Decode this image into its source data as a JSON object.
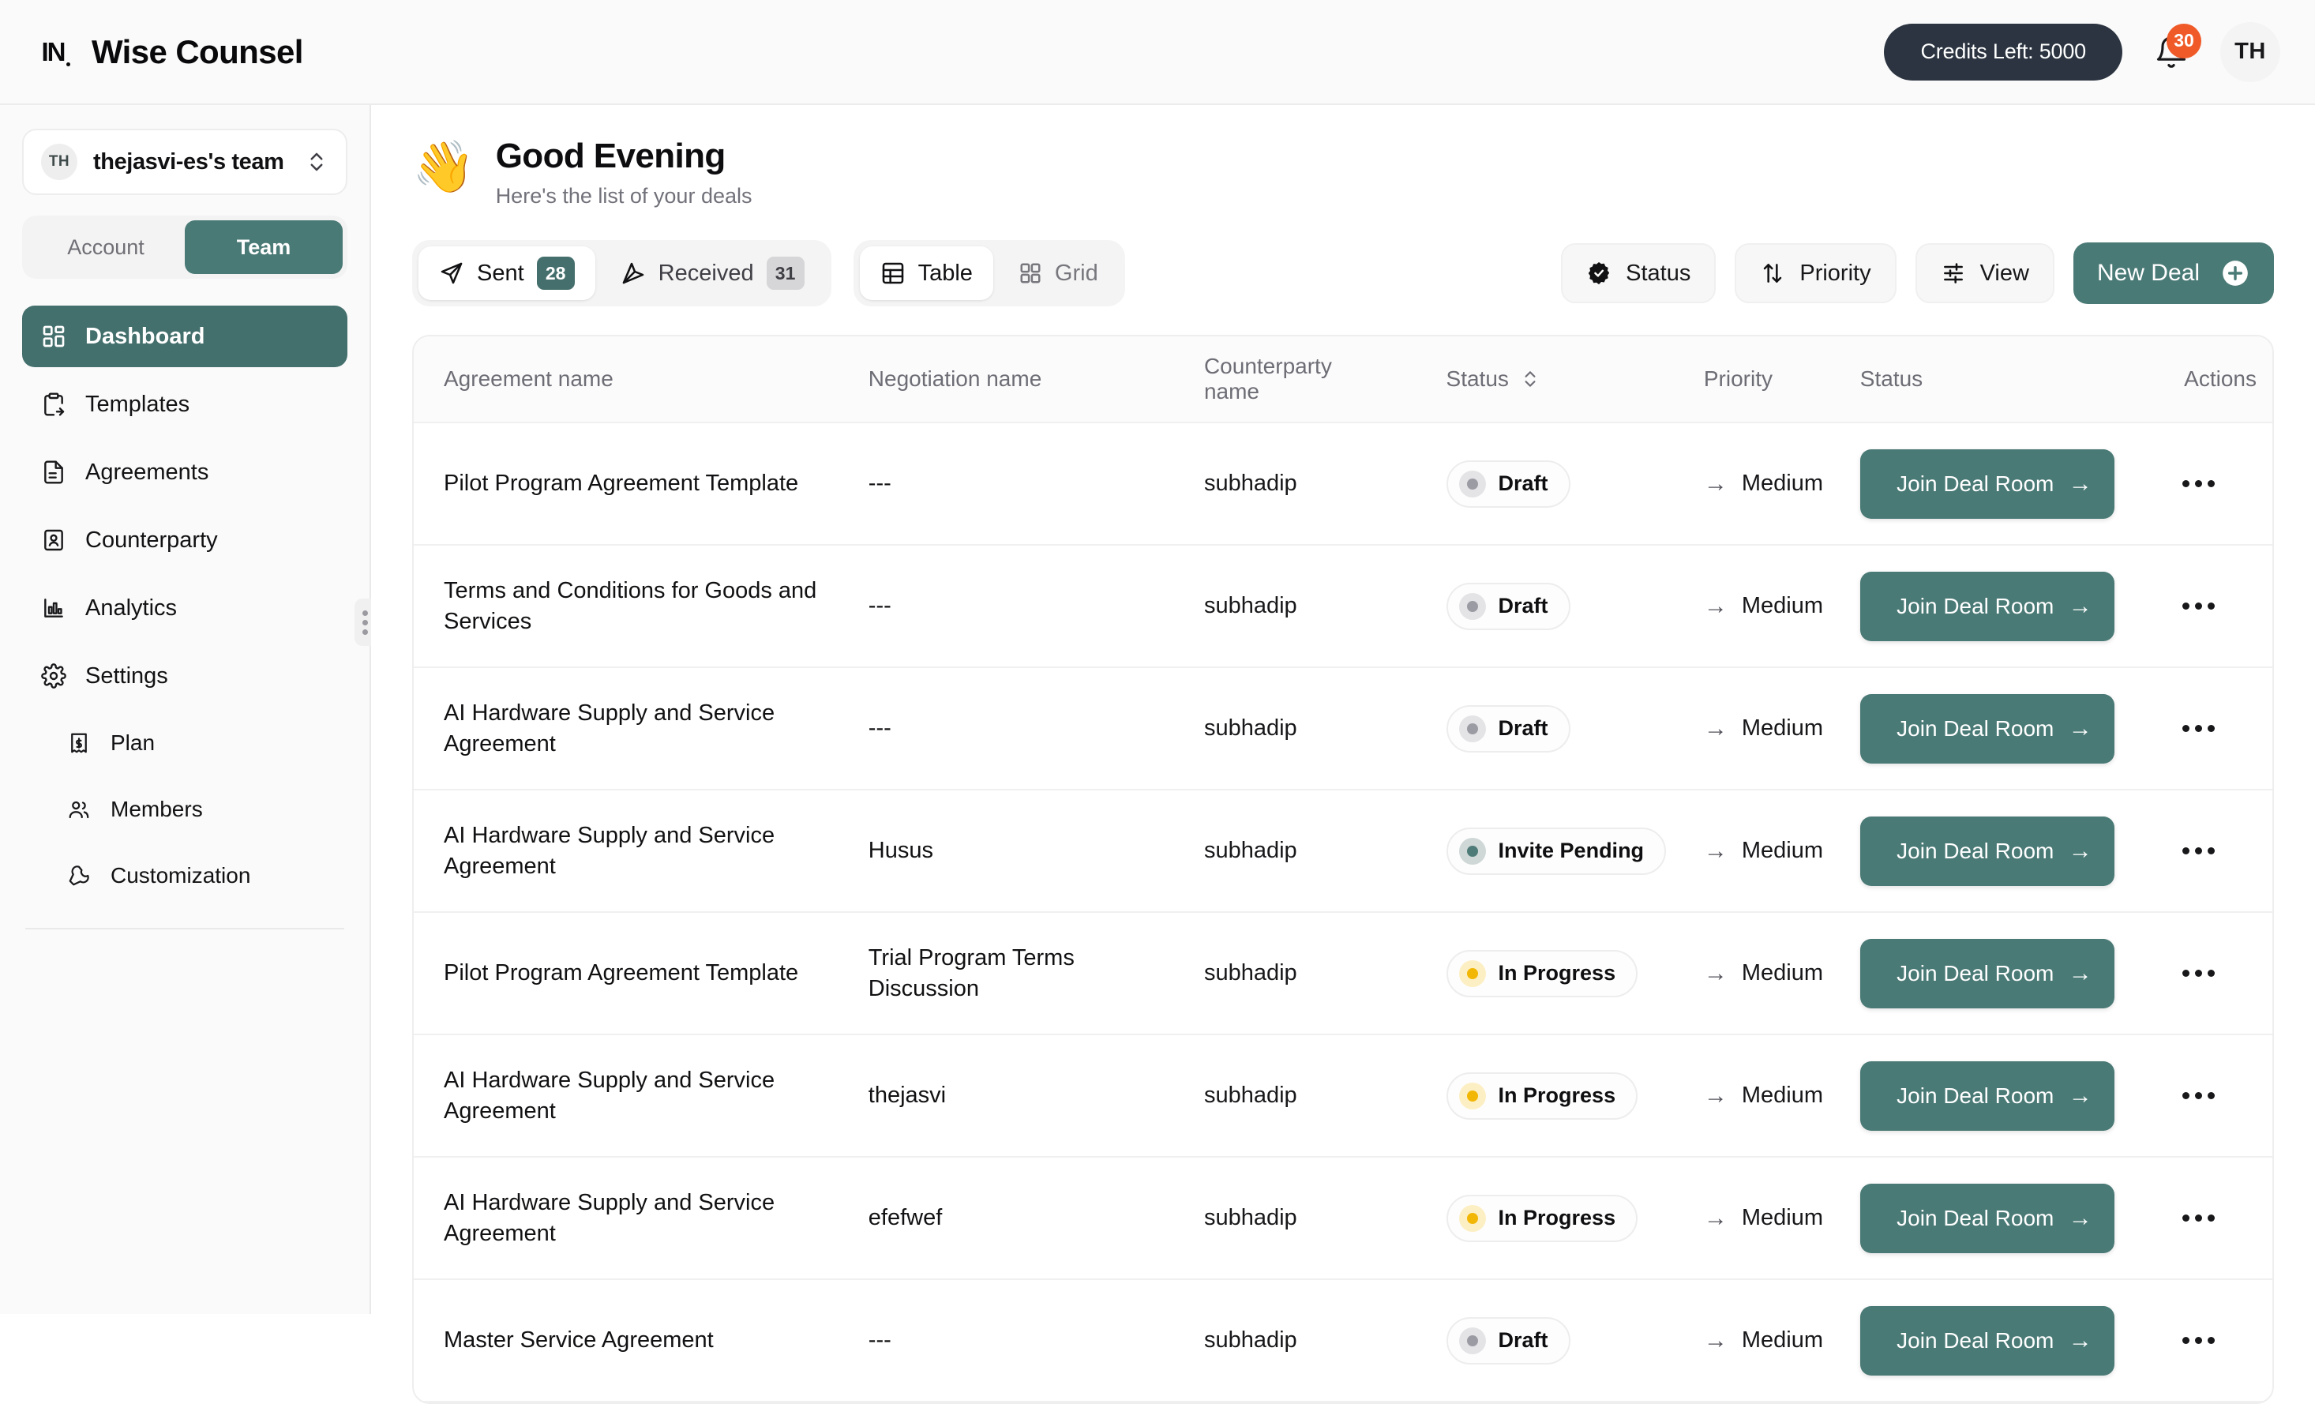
{
  "topbar": {
    "logo_mark": "IN",
    "brand_name": "Wise Counsel",
    "credits_label": "Credits Left: 5000",
    "notification_count": "30",
    "user_initials": "TH"
  },
  "sidebar": {
    "team": {
      "avatar_initials": "TH",
      "name": "thejasvi-es's team"
    },
    "account_toggle": {
      "account_label": "Account",
      "team_label": "Team",
      "selected": "Team"
    },
    "items": [
      {
        "label": "Dashboard",
        "icon": "grid-icon",
        "active": true
      },
      {
        "label": "Templates",
        "icon": "clipboard-export-icon",
        "active": false
      },
      {
        "label": "Agreements",
        "icon": "document-icon",
        "active": false
      },
      {
        "label": "Counterparty",
        "icon": "contact-card-icon",
        "active": false
      },
      {
        "label": "Analytics",
        "icon": "bar-chart-icon",
        "active": false
      },
      {
        "label": "Settings",
        "icon": "gear-icon",
        "active": false
      }
    ],
    "sub_items": [
      {
        "label": "Plan",
        "icon": "receipt-dollar-icon"
      },
      {
        "label": "Members",
        "icon": "users-icon"
      },
      {
        "label": "Customization",
        "icon": "wrench-icon"
      }
    ]
  },
  "main": {
    "greeting": {
      "emoji": "👋",
      "title": "Good Evening",
      "subtitle": "Here's the list of your deals"
    },
    "direction_tabs": [
      {
        "label": "Sent",
        "count": "28",
        "icon": "send-filled-icon",
        "active": true
      },
      {
        "label": "Received",
        "count": "31",
        "icon": "send-outline-icon",
        "active": false
      }
    ],
    "view_tabs": [
      {
        "label": "Table",
        "icon": "table-icon",
        "active": true
      },
      {
        "label": "Grid",
        "icon": "grid-icon",
        "active": false
      }
    ],
    "tool_buttons": [
      {
        "label": "Status",
        "icon": "badge-check-icon"
      },
      {
        "label": "Priority",
        "icon": "sort-arrows-icon"
      },
      {
        "label": "View",
        "icon": "sliders-icon"
      }
    ],
    "new_deal_label": "New Deal"
  },
  "table": {
    "columns": [
      {
        "label": "Agreement name",
        "sortable": false
      },
      {
        "label": "Negotiation name",
        "sortable": false
      },
      {
        "label": "Counterparty name",
        "sortable": false
      },
      {
        "label": "Status",
        "sortable": true
      },
      {
        "label": "Priority",
        "sortable": false
      },
      {
        "label": "Status",
        "sortable": false
      },
      {
        "label": "Actions",
        "sortable": false
      }
    ],
    "action_label": "Join Deal Room",
    "rows": [
      {
        "agreement": "Pilot Program Agreement Template",
        "negotiation": "---",
        "counterparty": "subhadip",
        "status": "Draft",
        "status_tone": "gray",
        "priority": "Medium",
        "action": "Join Deal Room"
      },
      {
        "agreement": "Terms and Conditions for Goods and Services",
        "negotiation": "---",
        "counterparty": "subhadip",
        "status": "Draft",
        "status_tone": "gray",
        "priority": "Medium",
        "action": "Join Deal Room"
      },
      {
        "agreement": "AI Hardware Supply and Service Agreement",
        "negotiation": "---",
        "counterparty": "subhadip",
        "status": "Draft",
        "status_tone": "gray",
        "priority": "Medium",
        "action": "Join Deal Room"
      },
      {
        "agreement": "AI Hardware Supply and Service Agreement",
        "negotiation": "Husus",
        "counterparty": "subhadip",
        "status": "Invite Pending",
        "status_tone": "teal",
        "priority": "Medium",
        "action": "Join Deal Room"
      },
      {
        "agreement": "Pilot Program Agreement Template",
        "negotiation": "Trial Program Terms Discussion",
        "counterparty": "subhadip",
        "status": "In Progress",
        "status_tone": "amber",
        "priority": "Medium",
        "action": "Join Deal Room"
      },
      {
        "agreement": "AI Hardware Supply and Service Agreement",
        "negotiation": "thejasvi",
        "counterparty": "subhadip",
        "status": "In Progress",
        "status_tone": "amber",
        "priority": "Medium",
        "action": "Join Deal Room"
      },
      {
        "agreement": "AI Hardware Supply and Service Agreement",
        "negotiation": "efefwef",
        "counterparty": "subhadip",
        "status": "In Progress",
        "status_tone": "amber",
        "priority": "Medium",
        "action": "Join Deal Room"
      },
      {
        "agreement": "Master Service Agreement",
        "negotiation": "---",
        "counterparty": "subhadip",
        "status": "Draft",
        "status_tone": "gray",
        "priority": "Medium",
        "action": "Join Deal Room"
      }
    ]
  },
  "colors": {
    "accent_teal": "#4a7a76",
    "accent_teal_dark": "#436f6c",
    "credits_dark": "#2b3440",
    "badge_orange": "#f05a28",
    "amber": "#f2b705",
    "surface": "#fafafa"
  }
}
